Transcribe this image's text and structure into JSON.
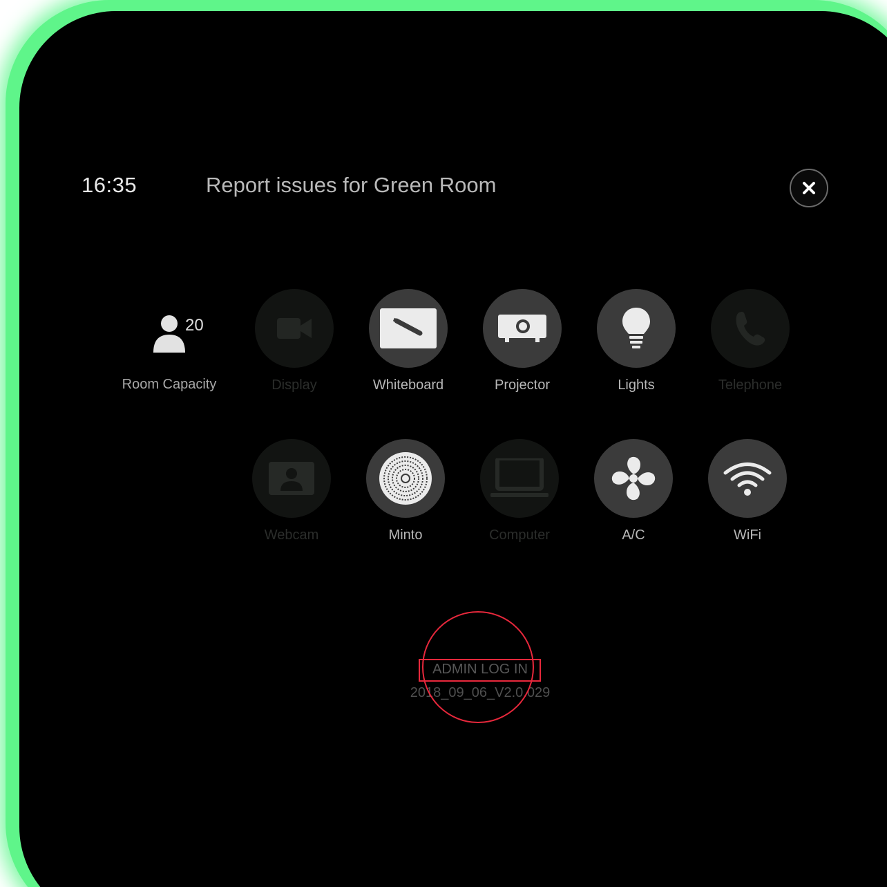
{
  "header": {
    "time": "16:35",
    "title": "Report issues for Green Room",
    "close_icon": "close-icon"
  },
  "capacity": {
    "count": "20",
    "label": "Room Capacity",
    "icon": "person-icon"
  },
  "issues": {
    "row1": [
      {
        "label": "Display",
        "icon": "video-camera-icon",
        "enabled": false
      },
      {
        "label": "Whiteboard",
        "icon": "whiteboard-icon",
        "enabled": true
      },
      {
        "label": "Projector",
        "icon": "projector-icon",
        "enabled": true
      },
      {
        "label": "Lights",
        "icon": "lightbulb-icon",
        "enabled": true
      },
      {
        "label": "Telephone",
        "icon": "phone-icon",
        "enabled": false
      }
    ],
    "row2": [
      {
        "label": "Webcam",
        "icon": "webcam-icon",
        "enabled": false
      },
      {
        "label": "Minto",
        "icon": "speaker-puck-icon",
        "enabled": true
      },
      {
        "label": "Computer",
        "icon": "laptop-icon",
        "enabled": false
      },
      {
        "label": "A/C",
        "icon": "fan-icon",
        "enabled": true
      },
      {
        "label": "WiFi",
        "icon": "wifi-icon",
        "enabled": true
      }
    ]
  },
  "footer": {
    "admin_label": "ADMIN LOG IN",
    "version": "2018_09_06_V2.0.029"
  },
  "colors": {
    "frame_glow": "#5ff58a",
    "highlight": "#e8283c",
    "active_circle": "#3b3b3b",
    "inactive_circle": "#121412"
  }
}
